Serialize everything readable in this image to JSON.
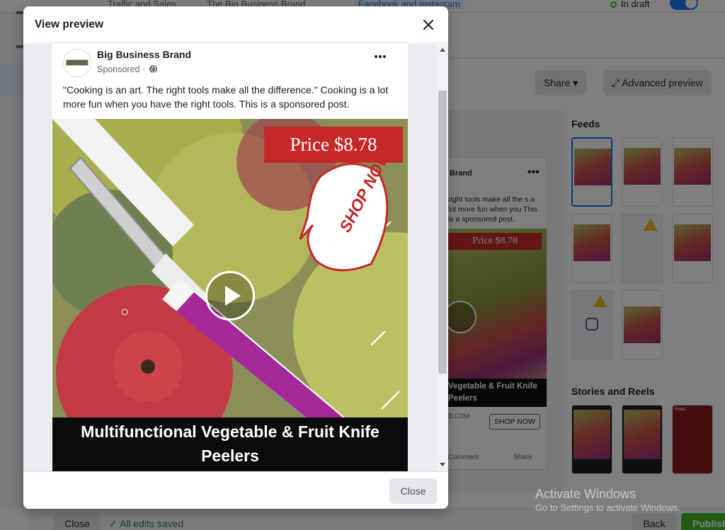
{
  "background": {
    "breadcrumbs": [
      {
        "label": "Traffic and Sales"
      },
      {
        "label": "The Big Business Brand"
      },
      {
        "label": "Facebook and Instagram"
      }
    ],
    "status": "In draft",
    "buttons": {
      "share": "Share",
      "advanced_preview": "Advanced preview"
    },
    "feed_card": {
      "brand": "Brand",
      "text": "right tools make all the s a lot more fun when you This is a sponsored post.",
      "price": "Price $8.78",
      "caption": "Vegetable & Fruit Knife Peelers",
      "domain": "D.COM",
      "cta": "SHOP NOW",
      "comment": "Comment",
      "share": "Share"
    },
    "sections": {
      "feeds": "Feeds",
      "stories_reels": "Stories and Reels"
    },
    "reels_label": "Reels",
    "footer": {
      "close": "Close",
      "saved": "All edits saved",
      "back": "Back",
      "publish": "Publish"
    },
    "watermark": {
      "title": "Activate Windows",
      "subtitle": "Go to Settings to activate Windows."
    }
  },
  "modal": {
    "title": "View preview",
    "close_label": "Close",
    "post": {
      "page_name": "Big Business Brand",
      "sponsored": "Sponsored ·",
      "text": "\"Cooking is an art. The right tools make all the difference.\" Cooking is a lot more fun when you have the right tools. This is a sponsored post.",
      "media": {
        "price": "Price $8.78",
        "badge": "SHOP NOW",
        "caption": "Multifunctional Vegetable & Fruit Knife Peelers"
      }
    }
  },
  "colors": {
    "accent": "#1877f2",
    "price_red": "#c62828",
    "handle_purple": "#a3299a",
    "publish_green": "#42b72a"
  },
  "icons": [
    "close-icon",
    "globe-icon",
    "more-icon",
    "play-icon",
    "warning-icon",
    "instagram-icon",
    "check-icon",
    "external-link-icon",
    "caret-down-icon"
  ]
}
